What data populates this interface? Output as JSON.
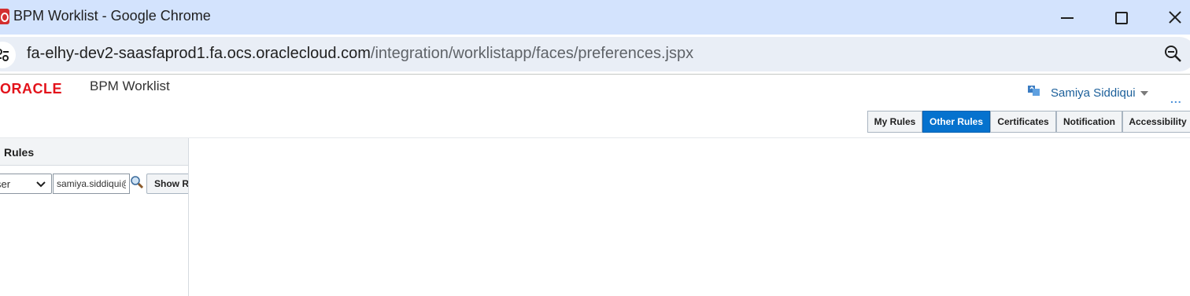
{
  "browser": {
    "window_title": "BPM Worklist - Google Chrome",
    "url_host": "fa-elhy-dev2-saasfaprod1.fa.ocs.oraclecloud.com",
    "url_path": "/integration/worklistapp/faces/preferences.jspx"
  },
  "app": {
    "logo_text": "ORACLE",
    "title": "BPM Worklist",
    "user_name": "Samiya Siddiqui",
    "more_menu": "..."
  },
  "tabs": [
    {
      "label": "My Rules",
      "active": false
    },
    {
      "label": "Other Rules",
      "active": true
    },
    {
      "label": "Certificates",
      "active": false
    },
    {
      "label": "Notification",
      "active": false
    },
    {
      "label": "Accessibility",
      "active": false
    }
  ],
  "left_panel": {
    "title": "Rules",
    "select_value": "ser",
    "user_input_value": "samiya.siddiqui@",
    "show_button_label": "Show R"
  },
  "colors": {
    "active_tab": "#0572ce",
    "oracle_red": "#e3131b",
    "titlebar": "#d3e3fd"
  }
}
